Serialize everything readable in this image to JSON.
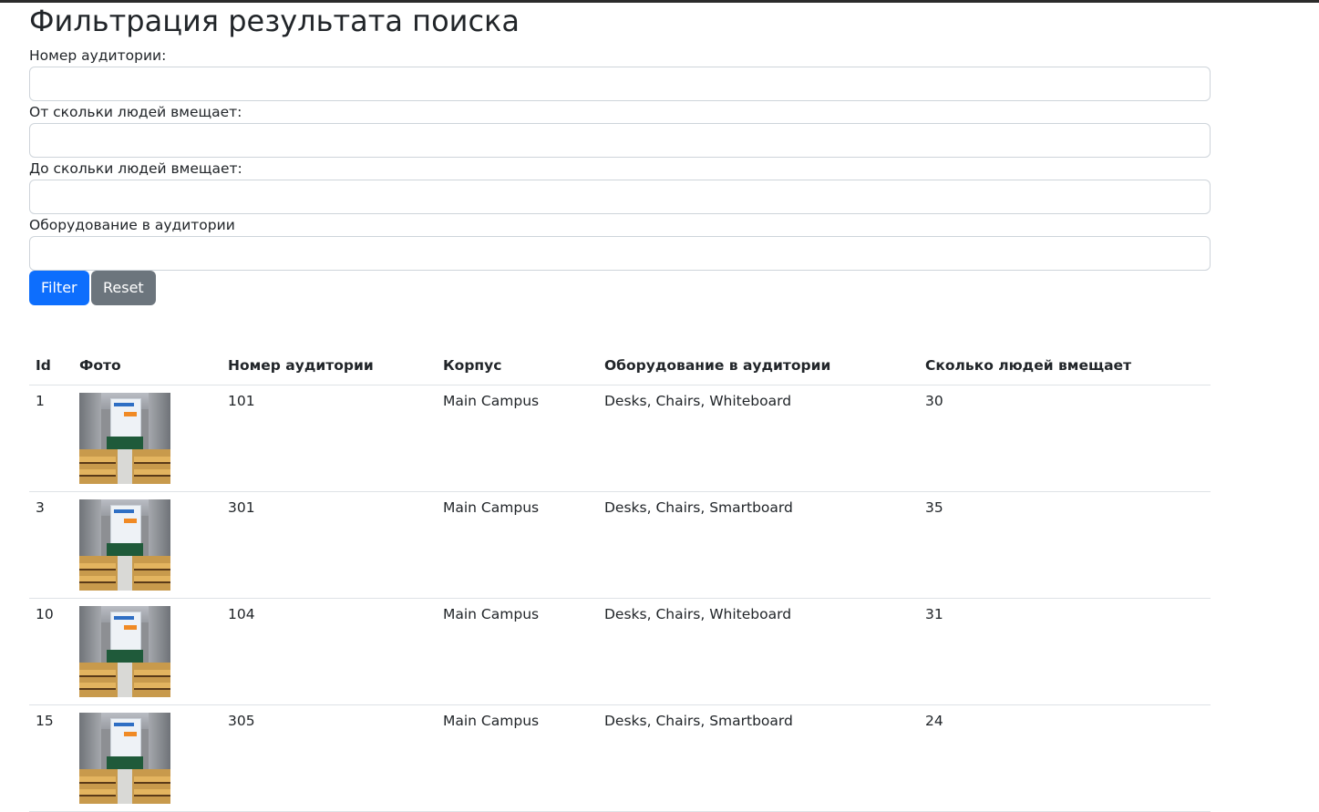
{
  "page_title": "Фильтрация результата поиска",
  "filters": [
    {
      "label": "Номер аудитории:",
      "value": ""
    },
    {
      "label": "От скольки людей вмещает:",
      "value": ""
    },
    {
      "label": "До скольки людей вмещает:",
      "value": ""
    },
    {
      "label": "Оборудование в аудитории",
      "value": ""
    }
  ],
  "buttons": {
    "filter": "Filter",
    "reset": "Reset"
  },
  "colors": {
    "primary": "#0d6efd",
    "secondary": "#6c757d"
  },
  "table": {
    "headers": [
      "Id",
      "Фото",
      "Номер аудитории",
      "Корпус",
      "Оборудование в аудитории",
      "Сколько людей вмещает"
    ],
    "rows": [
      {
        "id": "1",
        "photo": "classroom-photo",
        "room": "101",
        "building": "Main Campus",
        "equipment": "Desks, Chairs, Whiteboard",
        "capacity": "30"
      },
      {
        "id": "3",
        "photo": "classroom-photo",
        "room": "301",
        "building": "Main Campus",
        "equipment": "Desks, Chairs, Smartboard",
        "capacity": "35"
      },
      {
        "id": "10",
        "photo": "classroom-photo",
        "room": "104",
        "building": "Main Campus",
        "equipment": "Desks, Chairs, Whiteboard",
        "capacity": "31"
      },
      {
        "id": "15",
        "photo": "classroom-photo",
        "room": "305",
        "building": "Main Campus",
        "equipment": "Desks, Chairs, Smartboard",
        "capacity": "24"
      }
    ]
  }
}
